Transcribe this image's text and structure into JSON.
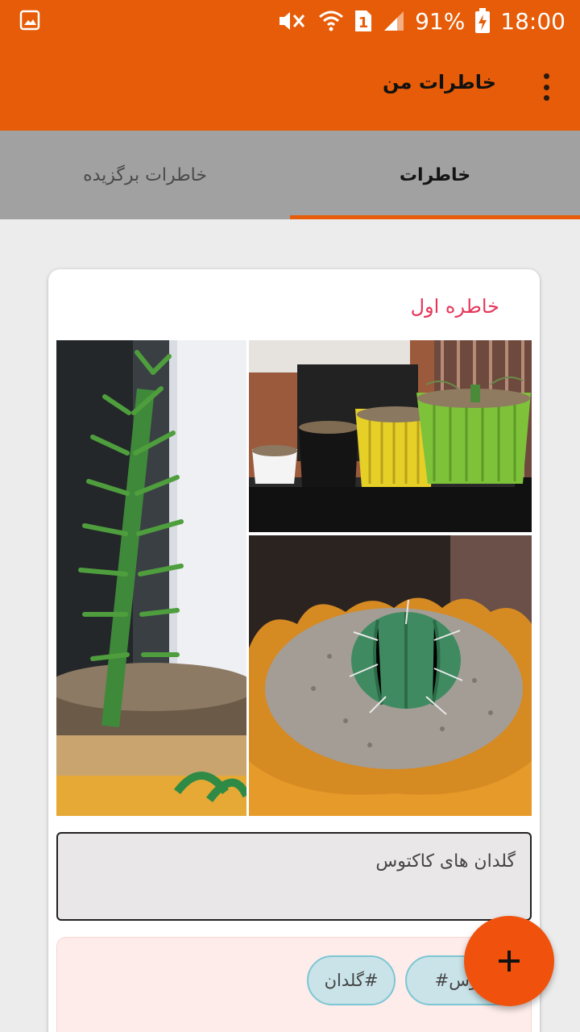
{
  "status_bar": {
    "battery": "91%",
    "time": "18:00",
    "sim_slot": "1",
    "icons": [
      "gallery-notification-icon",
      "mute-icon",
      "wifi-icon",
      "sim-icon",
      "signal-icon",
      "battery-charging-icon"
    ]
  },
  "toolbar": {
    "title": "خاطرات من",
    "menu_icon": "overflow-menu-icon"
  },
  "tabs": [
    {
      "label": "خاطرات",
      "selected": true
    },
    {
      "label": "خاطرات برگزیده",
      "selected": false
    }
  ],
  "memory": {
    "title": "خاطره اول",
    "photos": [
      "tall-cactus-photo",
      "potted-cacti-row-photo",
      "round-cactus-photo"
    ],
    "description": "گلدان های کاکتوس",
    "tags": [
      "کاکتوس#",
      "#گلدان"
    ]
  },
  "fab": {
    "icon": "plus-icon"
  },
  "colors": {
    "primary": "#e65c08",
    "accent": "#f0520d",
    "title_pink": "#e5365a",
    "tab_bar": "#a1a1a1",
    "tag_fill": "#c9e3e8"
  }
}
